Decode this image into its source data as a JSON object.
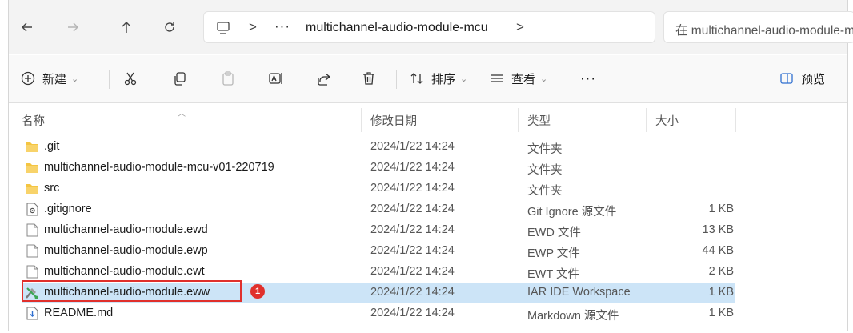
{
  "address": {
    "ellipsis": "···",
    "separator": ">",
    "crumb": "multichannel-audio-module-mcu",
    "search_placeholder": "在 multichannel-audio-module-mcu 中搜索"
  },
  "toolbar": {
    "new_label": "新建",
    "sort_label": "排序",
    "view_label": "查看",
    "more_label": "···",
    "preview_label": "预览",
    "chevron": "⌄"
  },
  "columns": {
    "name": "名称",
    "modified": "修改日期",
    "type": "类型",
    "size": "大小"
  },
  "files": [
    {
      "name": ".git",
      "date": "2024/1/22 14:24",
      "type": "文件夹",
      "size": "",
      "icon": "folder-icon"
    },
    {
      "name": "multichannel-audio-module-mcu-v01-220719",
      "date": "2024/1/22 14:24",
      "type": "文件夹",
      "size": "",
      "icon": "folder-icon"
    },
    {
      "name": "src",
      "date": "2024/1/22 14:24",
      "type": "文件夹",
      "size": "",
      "icon": "folder-icon"
    },
    {
      "name": ".gitignore",
      "date": "2024/1/22 14:24",
      "type": "Git Ignore 源文件",
      "size": "1 KB",
      "icon": "settings-file-icon"
    },
    {
      "name": "multichannel-audio-module.ewd",
      "date": "2024/1/22 14:24",
      "type": "EWD 文件",
      "size": "13 KB",
      "icon": "blank-file-icon"
    },
    {
      "name": "multichannel-audio-module.ewp",
      "date": "2024/1/22 14:24",
      "type": "EWP 文件",
      "size": "44 KB",
      "icon": "blank-file-icon"
    },
    {
      "name": "multichannel-audio-module.ewt",
      "date": "2024/1/22 14:24",
      "type": "EWT 文件",
      "size": "2 KB",
      "icon": "blank-file-icon"
    },
    {
      "name": "multichannel-audio-module.eww",
      "date": "2024/1/22 14:24",
      "type": "IAR IDE Workspace",
      "size": "1 KB",
      "icon": "iar-workspace-icon"
    },
    {
      "name": "README.md",
      "date": "2024/1/22 14:24",
      "type": "Markdown 源文件",
      "size": "1 KB",
      "icon": "markdown-file-icon"
    }
  ],
  "annotation": {
    "badge": "1"
  },
  "colors": {
    "selection": "#cce4f7",
    "highlight": "#e0302c",
    "folder": "#f4c542"
  }
}
